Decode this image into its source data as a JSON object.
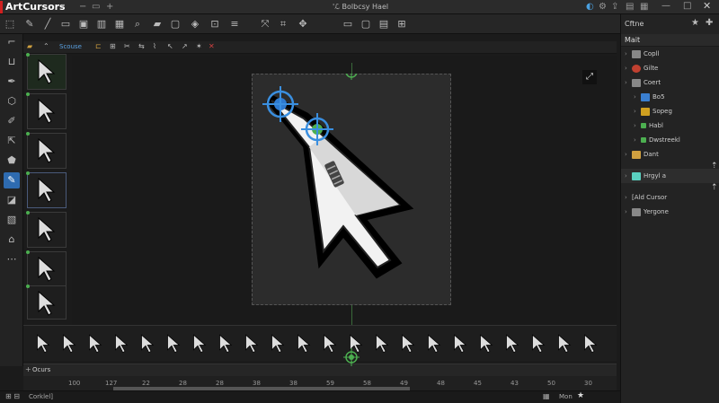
{
  "app": {
    "title": "ArtCursors",
    "document_title": "'ℒ Bolbcsy Hael"
  },
  "window": {
    "min": "—",
    "max": "□",
    "close": "✕"
  },
  "toolbar": {
    "tools": [
      "pointer-icon",
      "pen-icon",
      "line-icon",
      "rect-icon",
      "image-icon",
      "zoom-icon",
      "folder-icon",
      "frame-icon",
      "paint-icon",
      "transform-icon",
      "layers-icon",
      "eyedropper-icon",
      "crop-icon",
      "frame-add-icon",
      "window-icon",
      "ruler-icon"
    ]
  },
  "toolbar2": {
    "label": "Scouse"
  },
  "left_tools": {
    "items": [
      "crop-icon",
      "anchor-icon",
      "pen-icon",
      "eraser-icon",
      "brush-icon",
      "move-icon",
      "fill-icon",
      "pencil-icon",
      "bucket-icon",
      "grid-icon",
      "stamp-icon",
      "more-icon"
    ],
    "active_index": 7
  },
  "frames": {
    "count": 7
  },
  "strip": {
    "count": 22
  },
  "timeline": {
    "label": "Ocurs",
    "ticks": [
      "100",
      "127",
      "22",
      "28",
      "28",
      "38",
      "38",
      "59",
      "58",
      "49",
      "48",
      "45",
      "43",
      "50",
      "30"
    ]
  },
  "status": {
    "text": "Corklel]",
    "zoom": "Mon"
  },
  "right_panel": {
    "header": "Cftne",
    "section": "Mait",
    "tree": [
      {
        "label": "Copll",
        "level": 0,
        "icon": "folder",
        "color": "#888"
      },
      {
        "label": "Gilte",
        "level": 0,
        "icon": "circle",
        "color": "#c04030"
      },
      {
        "label": "Coert",
        "level": 0,
        "icon": "folder",
        "color": "#888"
      },
      {
        "label": "Bo5",
        "level": 1,
        "icon": "check",
        "color": "#3a7fd0"
      },
      {
        "label": "Sopeg",
        "level": 1,
        "icon": "square",
        "color": "#d0a020"
      },
      {
        "label": "Habl",
        "level": 1,
        "icon": "mini",
        "color": "#4caf50"
      },
      {
        "label": "Dwstreekl",
        "level": 1,
        "icon": "mini",
        "color": "#4caf50"
      },
      {
        "label": "Dant",
        "level": 0,
        "icon": "folder",
        "color": "#d0a040"
      },
      {
        "label": "Hrgyl a",
        "level": 0,
        "icon": "arrow",
        "color": "#5ad0c0"
      },
      {
        "label": "[Ald Cursor",
        "level": 0,
        "icon": "none",
        "color": "#888"
      },
      {
        "label": "Yergone",
        "level": 0,
        "icon": "folder",
        "color": "#888"
      }
    ]
  },
  "colors": {
    "accent": "#2e6bb0",
    "green": "#4caf50",
    "blue": "#2e7ad0",
    "bg": "#1b1b1b"
  }
}
